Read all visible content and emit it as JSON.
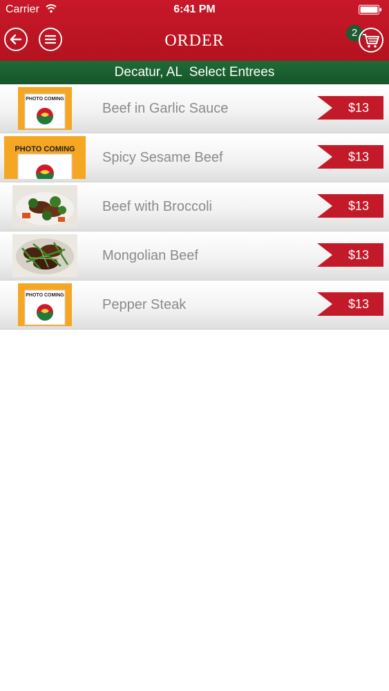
{
  "status_bar": {
    "carrier": "Carrier",
    "time": "6:41 PM"
  },
  "nav": {
    "title": "ORDER",
    "cart_count": "2"
  },
  "subheader": {
    "text": "Decatur, AL  Select Entrees"
  },
  "items": [
    {
      "name": "Beef in Garlic Sauce",
      "price": "$13",
      "image": "photo-coming",
      "photo_label": "PHOTO COMING"
    },
    {
      "name": "Spicy Sesame Beef",
      "price": "$13",
      "image": "photo-coming",
      "photo_label": "PHOTO COMING"
    },
    {
      "name": "Beef with Broccoli",
      "price": "$13",
      "image": "food-photo"
    },
    {
      "name": "Mongolian Beef",
      "price": "$13",
      "image": "food-photo"
    },
    {
      "name": "Pepper Steak",
      "price": "$13",
      "image": "photo-coming",
      "photo_label": "PHOTO COMING"
    }
  ],
  "colors": {
    "header_red": "#c8182a",
    "subheader_green": "#1f6b37",
    "price_red": "#c21a28",
    "badge_green": "#1e5b32"
  }
}
